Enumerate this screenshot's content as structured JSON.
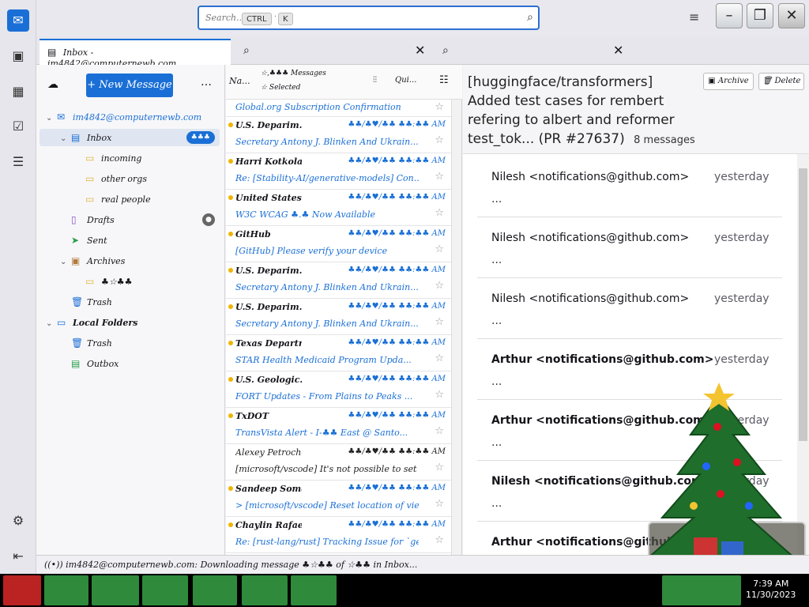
{
  "search": {
    "placeholder": "Search...",
    "kbd1": "CTRL",
    "kbd2": "K"
  },
  "window": {
    "hamburger": "≡",
    "minimize": "–",
    "restore": "❐",
    "close": "✕"
  },
  "tab": {
    "label": "Inbox - im4842@computernewb.com"
  },
  "toolbar": {
    "new_message": "+ New Message",
    "more": "…"
  },
  "folders": [
    {
      "label": "im4842@computernewb.com",
      "icon": "account-icon",
      "indent": 0,
      "twisty": "⌄",
      "blue": true
    },
    {
      "label": "Inbox",
      "icon": "inbox-icon",
      "indent": 1,
      "twisty": "⌄",
      "selected": true,
      "badge": "♣♣♣"
    },
    {
      "label": "incoming",
      "icon": "folder-icon",
      "indent": 2
    },
    {
      "label": "other orgs",
      "icon": "folder-icon",
      "indent": 2
    },
    {
      "label": "real people",
      "icon": "folder-icon",
      "indent": 2
    },
    {
      "label": "Drafts",
      "icon": "drafts-icon",
      "indent": 1,
      "badge_grey": "●"
    },
    {
      "label": "Sent",
      "icon": "sent-icon",
      "indent": 1
    },
    {
      "label": "Archives",
      "icon": "archive-icon",
      "indent": 1,
      "twisty": "⌄"
    },
    {
      "label": "♣☆♣♣",
      "icon": "folder-icon",
      "indent": 2
    },
    {
      "label": "Trash",
      "icon": "trash-icon",
      "indent": 1
    },
    {
      "label": "Local Folders",
      "icon": "local-folders-icon",
      "indent": 0,
      "twisty": "⌄"
    },
    {
      "label": "Trash",
      "icon": "trash-icon",
      "indent": 1
    },
    {
      "label": "Outbox",
      "icon": "outbox-icon",
      "indent": 1
    }
  ],
  "list_header": {
    "col1": "Na...",
    "count": "☆,♣♣♣ Messages",
    "selected": "☆ Selected",
    "quick": "Qui..."
  },
  "messages": [
    {
      "sender": "",
      "date": "",
      "subject": "Global.org Subscription Confirmation",
      "unread": true
    },
    {
      "sender": "U.S. Deparim...",
      "date": "♣♣/♣♥/♣♣ ♣♣:♣♣ AM",
      "subject": "Secretary Antony J. Blinken And Ukrain...",
      "unread": true
    },
    {
      "sender": "Harri Kotkola",
      "date": "♣♣/♣♥/♣♣ ♣♣:♣♣ AM",
      "subject": "Re: [Stability-AI/generative-models] Con...",
      "unread": true
    },
    {
      "sender": "United States ...",
      "date": "♣♣/♣♥/♣♣ ♣♣:♣♣ AM",
      "subject": "W3C WCAG ♣.♣ Now Available",
      "unread": true
    },
    {
      "sender": "GitHub",
      "date": "♣♣/♣♥/♣♣ ♣♣:♣♣ AM",
      "subject": "[GitHub] Please verify your device",
      "unread": true
    },
    {
      "sender": "U.S. Deparim...",
      "date": "♣♣/♣♥/♣♣ ♣♣:♣♣ AM",
      "subject": "Secretary Antony J. Blinken And Ukrain...",
      "unread": true
    },
    {
      "sender": "U.S. Deparim...",
      "date": "♣♣/♣♥/♣♣ ♣♣:♣♣ AM",
      "subject": "Secretary Antony J. Blinken And Ukrain...",
      "unread": true
    },
    {
      "sender": "Texas Departm...",
      "date": "♣♣/♣♥/♣♣ ♣♣:♣♣ AM",
      "subject": "STAR Health Medicaid Program Upda...",
      "unread": true
    },
    {
      "sender": "U.S. Geologic...",
      "date": "♣♣/♣♥/♣♣ ♣♣:♣♣ AM",
      "subject": "FORT Updates - From Plains to Peaks ...",
      "unread": true
    },
    {
      "sender": "TxDOT",
      "date": "♣♣/♣♥/♣♣ ♣♣:♣♣ AM",
      "subject": "TransVista Alert - I-♣♣ East @ Santo...",
      "unread": true
    },
    {
      "sender": "Alexey Petrochen...",
      "date": "♣♣/♣♥/♣♣ ♣♣:♣♣ AM",
      "subject": "[microsoft/vscode] It's not possible to set `editor...",
      "unread": false
    },
    {
      "sender": "Sandeep Somava...",
      "date": "♣♣/♣♥/♣♣ ♣♣:♣♣ AM",
      "subject": "> [microsoft/vscode] Reset location of view ...",
      "unread": true
    },
    {
      "sender": "Chaylin Rafael ...",
      "date": "♣♣/♣♥/♣♣ ♣♣:♣♣ AM",
      "subject": "Re: [rust-lang/rust] Tracking Issue for `ge...",
      "unread": true
    }
  ],
  "thread": {
    "title": "[huggingface/transformers] Added test cases for rembert refering to albert and reformer test_tok... (PR #27637)",
    "count": "8 messages",
    "archive": "Archive",
    "delete": "Delete",
    "items": [
      {
        "from": "Nilesh <notifications@github.com>",
        "when": "yesterday",
        "preview": "...",
        "unread": false
      },
      {
        "from": "Nilesh <notifications@github.com>",
        "when": "yesterday",
        "preview": "...",
        "unread": false
      },
      {
        "from": "Nilesh <notifications@github.com>",
        "when": "yesterday",
        "preview": "...",
        "unread": false
      },
      {
        "from": "Arthur <notifications@github.com>",
        "when": "yesterday",
        "preview": "...",
        "unread": true
      },
      {
        "from": "Arthur <notifications@github.com>",
        "when": "yesterday",
        "preview": "...",
        "unread": true
      },
      {
        "from": "Nilesh <notifications@github.com>",
        "when": "yesterday",
        "preview": "...",
        "unread": true
      },
      {
        "from": "Arthur <notifications@github.com>",
        "when": "yesterday",
        "preview": "...",
        "unread": true
      }
    ]
  },
  "status": {
    "text": "im4842@computernewb.com: Downloading message ♣☆♣♣ of ☆♣♣ in Inbox..."
  },
  "tray": {
    "time": "7:39 AM",
    "date": "11/30/2023"
  },
  "colors": {
    "accent": "#1a6fd6",
    "unread_dot": "#f0b400",
    "taskbar_green": "#2f8a3b"
  }
}
